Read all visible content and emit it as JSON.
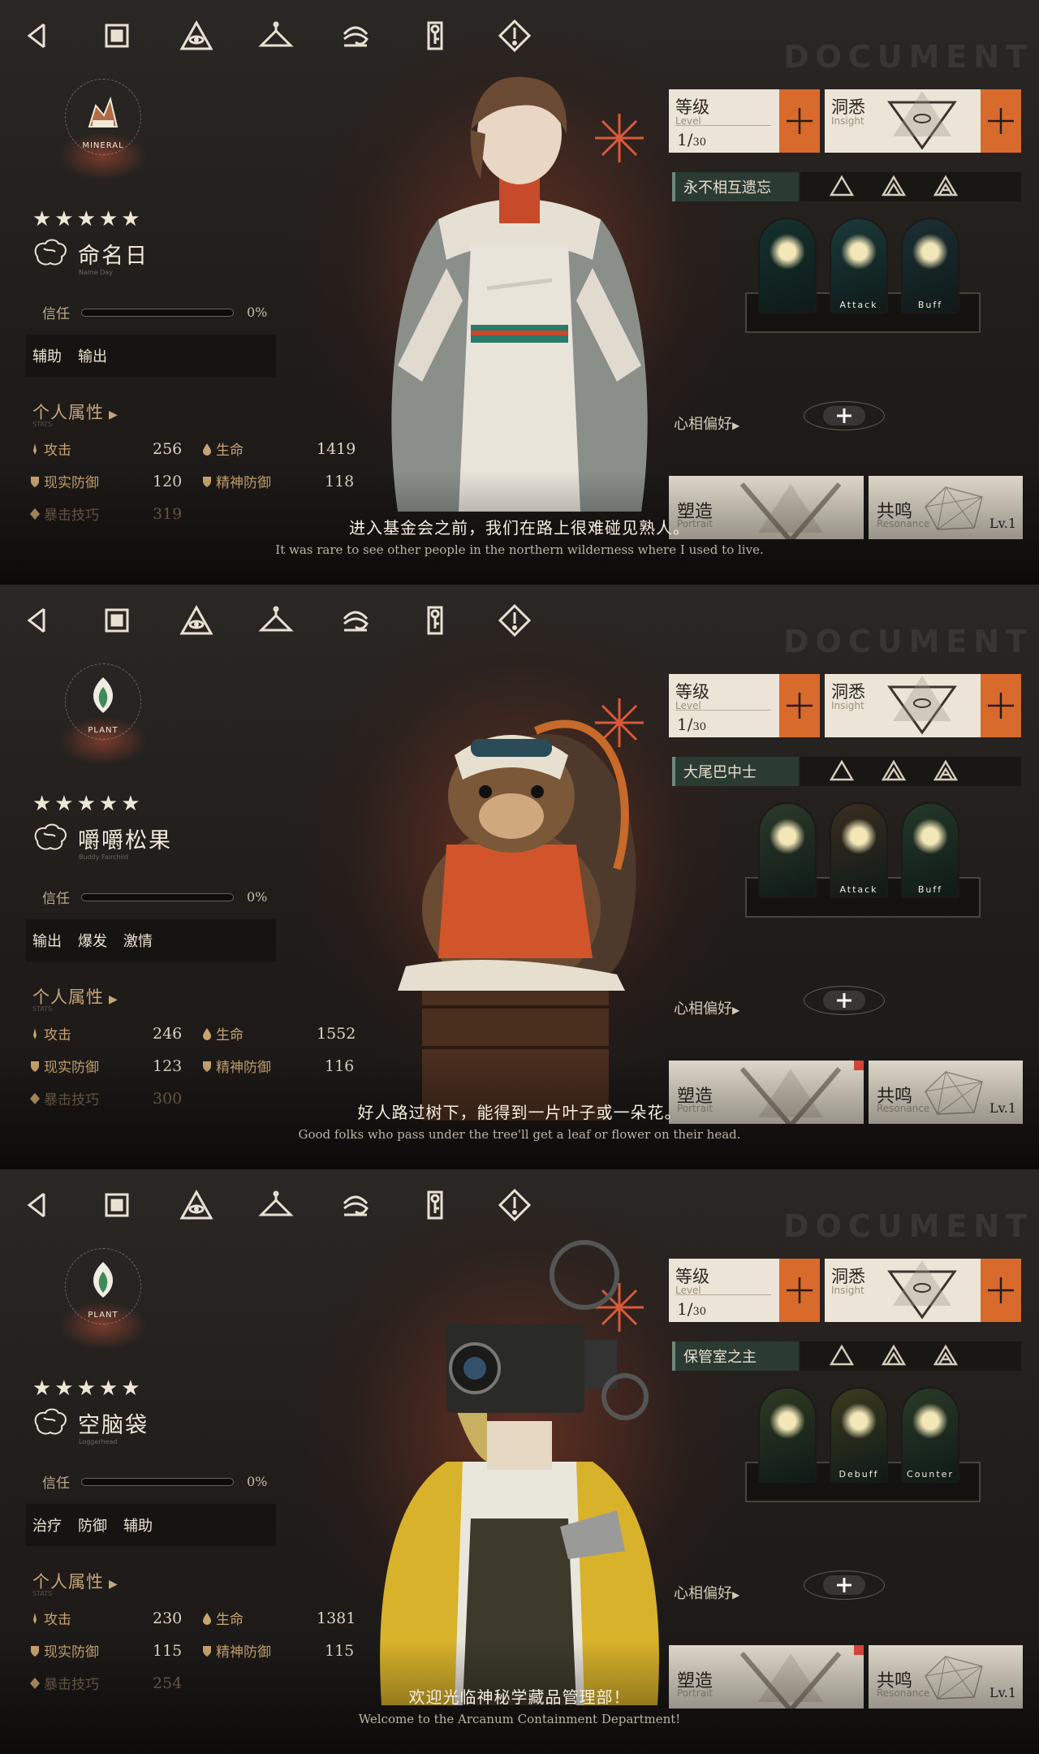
{
  "nav": [
    {
      "name": "back-icon"
    },
    {
      "name": "home-icon"
    },
    {
      "name": "eye-triangle-icon"
    },
    {
      "name": "hanger-icon"
    },
    {
      "name": "wave-icon"
    },
    {
      "name": "key-card-icon"
    },
    {
      "name": "warning-icon"
    }
  ],
  "watermark": "DOCUMENT",
  "panels": [
    {
      "emblem_type": "MINERAL",
      "stars": "★★★★★",
      "name": "命名日",
      "name_en": "Name Day",
      "trust_label": "信任",
      "trust_pct": "0%",
      "trust_value": 0,
      "tags": [
        "辅助",
        "输出"
      ],
      "attr_head": "个人属性",
      "attr_sub": "STATS",
      "stats": {
        "atk_label": "攻击",
        "atk": "256",
        "hp_label": "生命",
        "hp": "1419",
        "rdef_label": "现实防御",
        "rdef": "120",
        "mdef_label": "精神防御",
        "mdef": "118",
        "crit_label": "暴击技巧",
        "crit": "319"
      },
      "level_title": "等级",
      "level_sub": "Level",
      "level_cur": "1",
      "level_max": "30",
      "insight_title": "洞悉",
      "insight_sub": "Insight",
      "skill_name": "永不相互遗忘",
      "skills": [
        {
          "caption": ""
        },
        {
          "caption": "Attack"
        },
        {
          "caption": "Buff"
        }
      ],
      "pref_label": "心相偏好",
      "shape_title": "塑造",
      "shape_sub": "Portrait",
      "reso_title": "共鸣",
      "reso_sub": "Resonance",
      "reso_lv": "Lv.1",
      "subtitle": "进入基金会之前，我们在路上很难碰见熟人。",
      "subtitle_en": "It was rare to see other people in the northern wilderness where I used to live.",
      "colors": {
        "emblem": "#b06a45",
        "skill_bg": [
          "#14322e",
          "#1a3a3a",
          "#1c2f33"
        ]
      }
    },
    {
      "emblem_type": "PLANT",
      "stars": "★★★★★",
      "name": "嚼嚼松果",
      "name_en": "Buddy Fairchild",
      "trust_label": "信任",
      "trust_pct": "0%",
      "trust_value": 0,
      "tags": [
        "输出",
        "爆发",
        "激情"
      ],
      "attr_head": "个人属性",
      "attr_sub": "STATS",
      "stats": {
        "atk_label": "攻击",
        "atk": "246",
        "hp_label": "生命",
        "hp": "1552",
        "rdef_label": "现实防御",
        "rdef": "123",
        "mdef_label": "精神防御",
        "mdef": "116",
        "crit_label": "暴击技巧",
        "crit": "300"
      },
      "level_title": "等级",
      "level_sub": "Level",
      "level_cur": "1",
      "level_max": "30",
      "insight_title": "洞悉",
      "insight_sub": "Insight",
      "skill_name": "大尾巴中士",
      "skills": [
        {
          "caption": ""
        },
        {
          "caption": "Attack"
        },
        {
          "caption": "Buff"
        }
      ],
      "pref_label": "心相偏好",
      "shape_title": "塑造",
      "shape_sub": "Portrait",
      "reso_title": "共鸣",
      "reso_sub": "Resonance",
      "reso_lv": "Lv.1",
      "subtitle": "好人路过树下，能得到一片叶子或一朵花。",
      "subtitle_en": "Good folks who pass under the tree'll get a leaf or flower on their head.",
      "colors": {
        "emblem": "#3f8a5a",
        "skill_bg": [
          "#2c3a2a",
          "#3a2e20",
          "#243828"
        ]
      }
    },
    {
      "emblem_type": "PLANT",
      "stars": "★★★★★",
      "name": "空脑袋",
      "name_en": "Loggerhead",
      "trust_label": "信任",
      "trust_pct": "0%",
      "trust_value": 0,
      "tags": [
        "治疗",
        "防御",
        "辅助"
      ],
      "attr_head": "个人属性",
      "attr_sub": "STATS",
      "stats": {
        "atk_label": "攻击",
        "atk": "230",
        "hp_label": "生命",
        "hp": "1381",
        "rdef_label": "现实防御",
        "rdef": "115",
        "mdef_label": "精神防御",
        "mdef": "115",
        "crit_label": "暴击技巧",
        "crit": "254"
      },
      "level_title": "等级",
      "level_sub": "Level",
      "level_cur": "1",
      "level_max": "30",
      "insight_title": "洞悉",
      "insight_sub": "Insight",
      "skill_name": "保管室之主",
      "skills": [
        {
          "caption": ""
        },
        {
          "caption": "Debuff"
        },
        {
          "caption": "Counter"
        }
      ],
      "pref_label": "心相偏好",
      "shape_title": "塑造",
      "shape_sub": "Portrait",
      "reso_title": "共鸣",
      "reso_sub": "Resonance",
      "reso_lv": "Lv.1",
      "subtitle": "欢迎光临神秘学藏品管理部！",
      "subtitle_en": "Welcome to the Arcanum Containment Department!",
      "colors": {
        "emblem": "#3f8a5a",
        "skill_bg": [
          "#2f3a22",
          "#3a3a1e",
          "#2a3a26"
        ]
      }
    }
  ]
}
